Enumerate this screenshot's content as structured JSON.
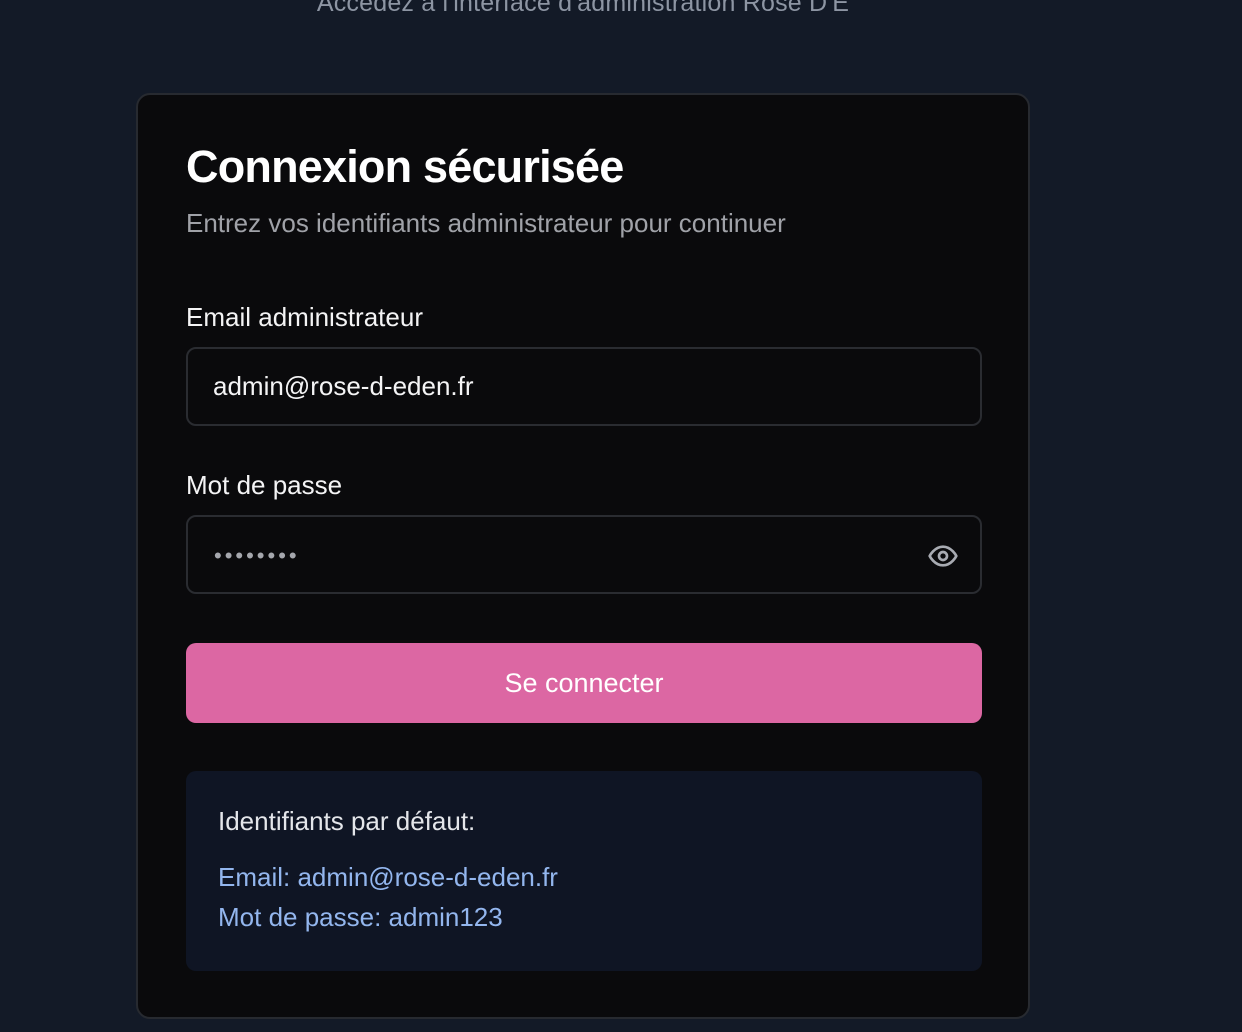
{
  "header": {
    "subtitle": "Accédez à l'interface d'administration Rose D'E"
  },
  "login_card": {
    "title": "Connexion sécurisée",
    "description": "Entrez vos identifiants administrateur pour continuer",
    "email_field": {
      "label": "Email administrateur",
      "value": "admin@rose-d-eden.fr"
    },
    "password_field": {
      "label": "Mot de passe",
      "masked_value": "••••••••",
      "toggle_icon": "eye-icon"
    },
    "submit_label": "Se connecter",
    "default_credentials": {
      "title": "Identifiants par défaut:",
      "email_line": "Email: admin@rose-d-eden.fr",
      "password_line": "Mot de passe: admin123"
    }
  },
  "colors": {
    "page_background": "#131a27",
    "card_background": "#0a0a0c",
    "accent": "#dc67a3",
    "info_background": "#0f1524",
    "info_text": "#93b6ee"
  }
}
